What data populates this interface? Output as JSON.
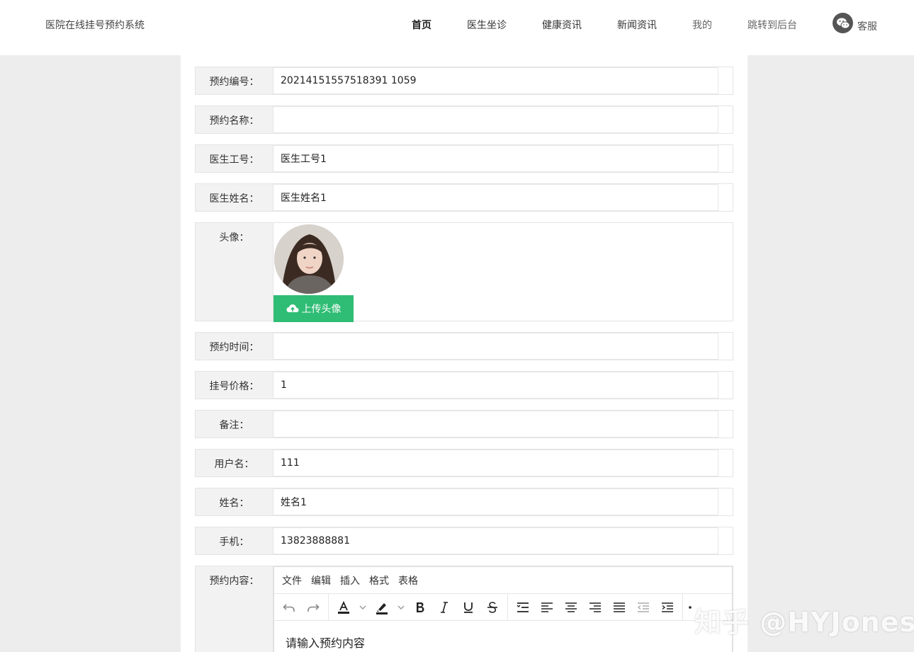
{
  "header": {
    "brand": "医院在线挂号预约系统",
    "nav": [
      "首页",
      "医生坐诊",
      "健康资讯",
      "新闻资讯",
      "我的",
      "跳转到后台"
    ],
    "customer_service": "客服"
  },
  "form": {
    "appointment_no": {
      "label": "预约编号：",
      "value": "20214151557518391 1059"
    },
    "appointment_name": {
      "label": "预约名称：",
      "value": ""
    },
    "doctor_id": {
      "label": "医生工号：",
      "value": "医生工号1"
    },
    "doctor_name": {
      "label": "医生姓名：",
      "value": "医生姓名1"
    },
    "avatar": {
      "label": "头像：",
      "upload_label": "上传头像"
    },
    "appointment_time": {
      "label": "预约时间：",
      "value": ""
    },
    "price": {
      "label": "挂号价格：",
      "value": "1"
    },
    "remark": {
      "label": "备注：",
      "value": ""
    },
    "username": {
      "label": "用户名：",
      "value": "111"
    },
    "realname": {
      "label": "姓名：",
      "value": "姓名1"
    },
    "phone": {
      "label": "手机：",
      "value": "13823888881"
    },
    "content": {
      "label": "预约内容：",
      "placeholder": "请输入预约内容"
    }
  },
  "editor": {
    "menus": [
      "文件",
      "编辑",
      "插入",
      "格式",
      "表格"
    ]
  },
  "watermark": "知乎 @HYJones"
}
